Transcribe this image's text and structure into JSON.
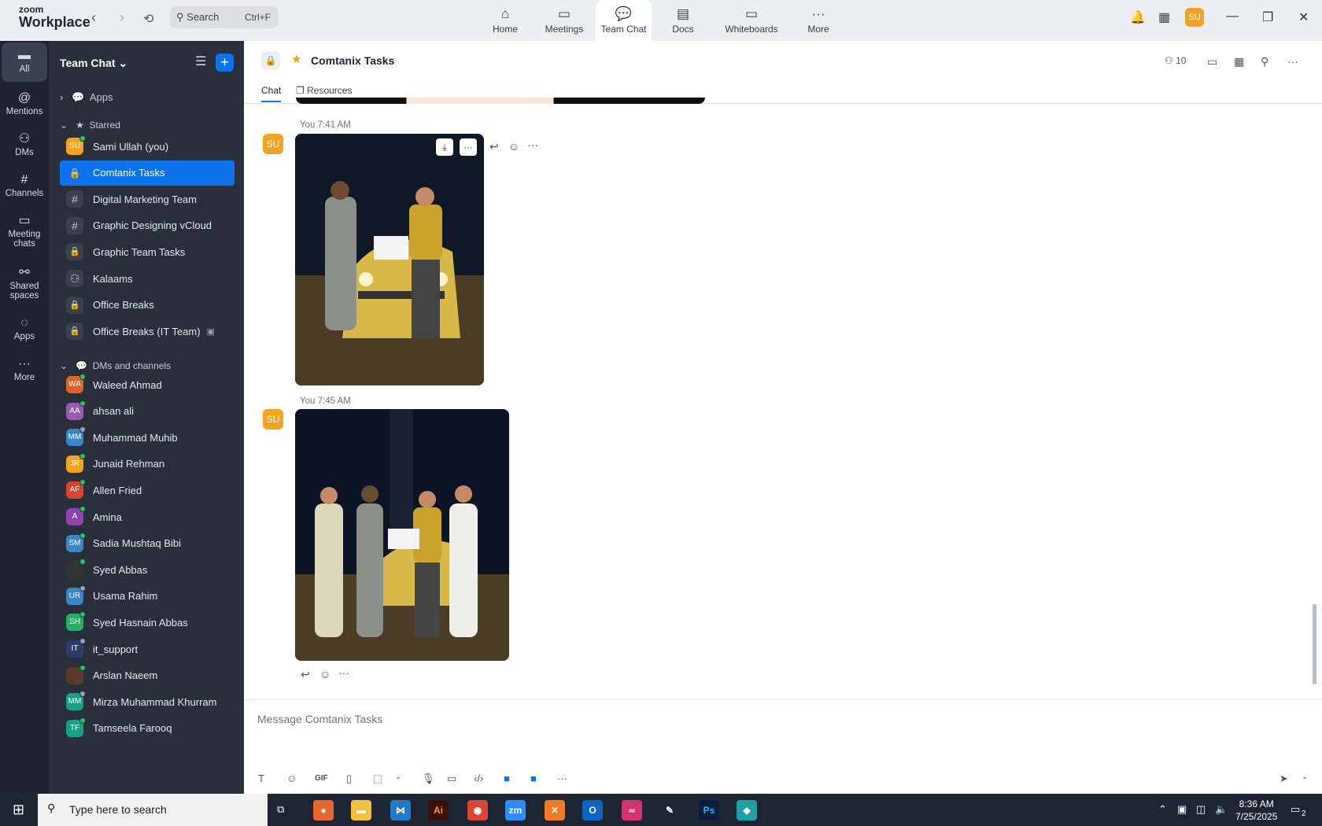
{
  "brand": {
    "line1": "zoom",
    "line2": "Workplace"
  },
  "search": {
    "label": "Search",
    "shortcut": "Ctrl+F"
  },
  "main_tabs": [
    {
      "label": "Home",
      "icon": "home-icon"
    },
    {
      "label": "Meetings",
      "icon": "video-icon"
    },
    {
      "label": "Team Chat",
      "icon": "chat-icon",
      "active": true
    },
    {
      "label": "Docs",
      "icon": "doc-icon"
    },
    {
      "label": "Whiteboards",
      "icon": "whiteboard-icon"
    },
    {
      "label": "More",
      "icon": "more-icon"
    }
  ],
  "user_initials": "SU",
  "rail": [
    {
      "label": "All",
      "icon": "chat-icon",
      "active": true
    },
    {
      "label": "Mentions",
      "icon": "at-icon"
    },
    {
      "label": "DMs",
      "icon": "people-icon"
    },
    {
      "label": "Channels",
      "icon": "hash-icon"
    },
    {
      "label": "Meeting chats",
      "icon": "calendar-icon"
    },
    {
      "label": "Shared spaces",
      "icon": "share-icon"
    },
    {
      "label": "Apps",
      "icon": "apps-icon"
    },
    {
      "label": "More",
      "icon": "more-icon"
    }
  ],
  "sidebar": {
    "title": "Team Chat",
    "apps_label": "Apps",
    "starred_label": "Starred",
    "dms_label": "DMs and channels",
    "starred": [
      {
        "label": "Sami Ullah (you)",
        "type": "avatar",
        "initials": "SU",
        "color": "#f2a321",
        "status": "online"
      },
      {
        "label": "Comtanix Tasks",
        "type": "lockw",
        "active": true
      },
      {
        "label": "Digital Marketing Team",
        "type": "hash"
      },
      {
        "label": "Graphic Designing vCloud",
        "type": "hash"
      },
      {
        "label": "Graphic Team Tasks",
        "type": "lock"
      },
      {
        "label": "Kalaams",
        "type": "group"
      },
      {
        "label": "Office Breaks",
        "type": "lock"
      },
      {
        "label": "Office Breaks (IT Team)",
        "type": "lock",
        "archived": true
      }
    ],
    "dms": [
      {
        "label": "Waleed Ahmad",
        "initials": "WA",
        "color": "#e0632a",
        "status": "online"
      },
      {
        "label": "ahsan ali",
        "initials": "AA",
        "color": "#9b59b6",
        "status": "online"
      },
      {
        "label": "Muhammad Muhib",
        "initials": "MM",
        "color": "#3a86c8",
        "status": "off"
      },
      {
        "label": "Junaid Rehman",
        "initials": "JR",
        "color": "#f2a321",
        "status": "online"
      },
      {
        "label": "Allen Fried",
        "initials": "AF",
        "color": "#d9432f",
        "status": "online"
      },
      {
        "label": "Amina",
        "initials": "A",
        "color": "#8e44ad",
        "status": "online"
      },
      {
        "label": "Sadia Mushtaq Bibi",
        "initials": "SM",
        "color": "#3a86c8",
        "status": "online"
      },
      {
        "label": "Syed Abbas",
        "initials": "",
        "color": "#333",
        "status": "online"
      },
      {
        "label": "Usama Rahim",
        "initials": "UR",
        "color": "#3a86c8",
        "status": "off"
      },
      {
        "label": "Syed Hasnain Abbas",
        "initials": "SH",
        "color": "#27ae60",
        "status": "online"
      },
      {
        "label": "it_support",
        "initials": "IT",
        "color": "#2d3b6e",
        "status": "off"
      },
      {
        "label": "Arslan Naeem",
        "initials": "",
        "color": "#5a3a2a",
        "status": "online"
      },
      {
        "label": "Mirza Muhammad Khurram",
        "initials": "MM",
        "color": "#16a085",
        "status": "off"
      },
      {
        "label": "Tamseela Farooq",
        "initials": "TF",
        "color": "#16a085",
        "status": "online"
      }
    ]
  },
  "channel": {
    "title": "Comtanix Tasks",
    "member_count": "10",
    "tabs": [
      {
        "label": "Chat",
        "active": true
      },
      {
        "label": "Resources"
      }
    ]
  },
  "messages": [
    {
      "author_initials": "SU",
      "meta": "You 7:41 AM"
    },
    {
      "author_initials": "SU",
      "meta": "You 7:45 AM"
    }
  ],
  "composer": {
    "placeholder": "Message Comtanix Tasks",
    "gif_label": "GIF"
  },
  "taskbar": {
    "search_placeholder": "Type here to search",
    "time": "8:36 AM",
    "date": "7/25/2025",
    "notif_count": "2"
  }
}
